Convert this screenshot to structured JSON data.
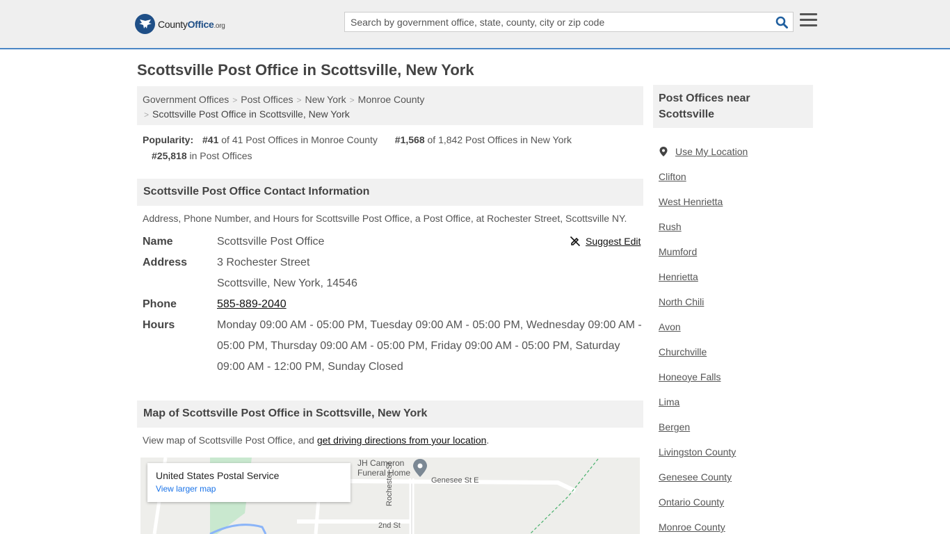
{
  "header": {
    "logo_county": "County",
    "logo_office": "Office",
    "logo_tld": ".org",
    "search_placeholder": "Search by government office, state, county, city or zip code"
  },
  "page": {
    "title": "Scottsville Post Office in Scottsville, New York"
  },
  "breadcrumb": [
    "Government Offices",
    "Post Offices",
    "New York",
    "Monroe County",
    "Scottsville Post Office in Scottsville, New York"
  ],
  "popularity": {
    "label": "Popularity:",
    "county_rank": "#41",
    "county_text": "of 41 Post Offices in Monroe County",
    "state_rank": "#1,568",
    "state_text": "of 1,842 Post Offices in New York",
    "national_rank": "#25,818",
    "national_text": "in Post Offices"
  },
  "contact": {
    "heading": "Scottsville Post Office Contact Information",
    "description": "Address, Phone Number, and Hours for Scottsville Post Office, a Post Office, at Rochester Street, Scottsville NY.",
    "suggest_edit": "Suggest Edit",
    "name_label": "Name",
    "name_value": "Scottsville Post Office",
    "address_label": "Address",
    "address_line1": "3 Rochester Street",
    "address_line2": "Scottsville, New York, 14546",
    "phone_label": "Phone",
    "phone_value": "585-889-2040",
    "hours_label": "Hours",
    "hours_value": "Monday 09:00 AM - 05:00 PM, Tuesday 09:00 AM - 05:00 PM, Wednesday 09:00 AM - 05:00 PM, Thursday 09:00 AM - 05:00 PM, Friday 09:00 AM - 05:00 PM, Saturday 09:00 AM - 12:00 PM, Sunday Closed"
  },
  "map": {
    "heading": "Map of Scottsville Post Office in Scottsville, New York",
    "desc_prefix": "View map of Scottsville Post Office, and ",
    "desc_link": "get driving directions from your location",
    "desc_suffix": ".",
    "card_title": "United States Postal Service",
    "card_link": "View larger map",
    "label_funeral_1": "JH Cameron",
    "label_funeral_2": "Funeral Home",
    "label_genesee": "Genesee St E",
    "label_2nd": "2nd St",
    "label_rochester": "Rochester St"
  },
  "sidebar": {
    "heading_line1": "Post Offices near",
    "heading_line2": "Scottsville",
    "use_location": "Use My Location",
    "items": [
      "Clifton",
      "West Henrietta",
      "Rush",
      "Mumford",
      "Henrietta",
      "North Chili",
      "Avon",
      "Churchville",
      "Honeoye Falls",
      "Lima",
      "Bergen",
      "Livingston County",
      "Genesee County",
      "Ontario County",
      "Monroe County"
    ]
  }
}
